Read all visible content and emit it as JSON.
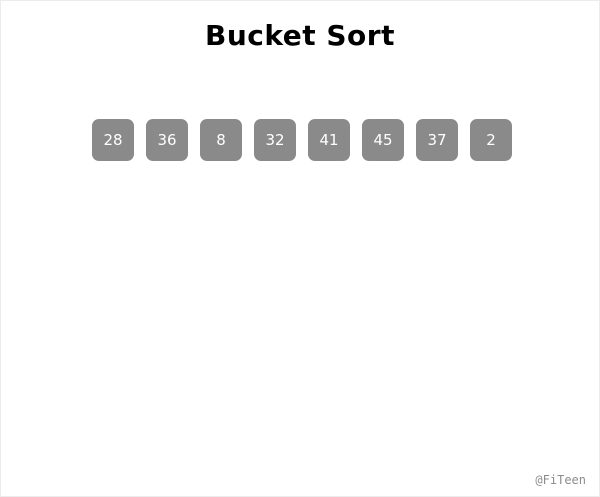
{
  "title": "Bucket Sort",
  "array": {
    "values": [
      "28",
      "36",
      "8",
      "32",
      "41",
      "45",
      "37",
      "2"
    ]
  },
  "watermark": "@FiTeen",
  "colors": {
    "cell_background": "#8a8a8a",
    "cell_text": "#ffffff",
    "title": "#000000",
    "watermark": "#8c8c8c"
  }
}
